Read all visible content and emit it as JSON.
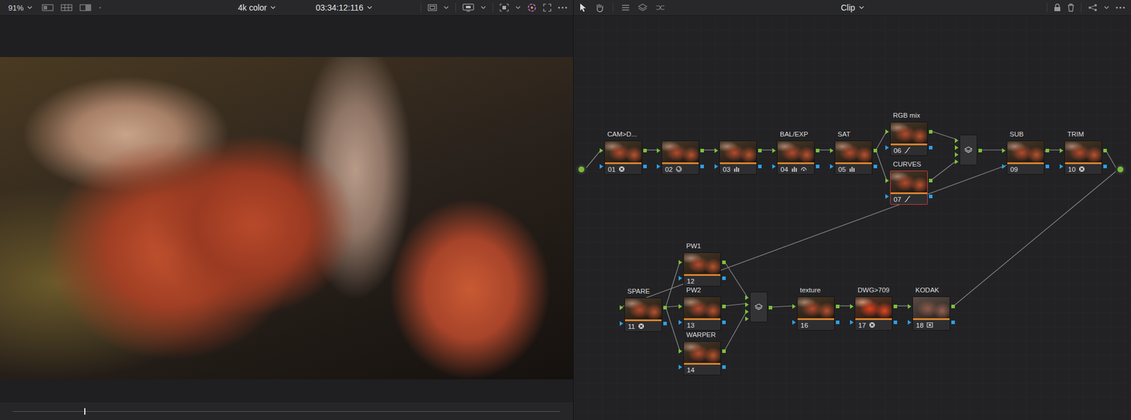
{
  "viewer": {
    "zoom": "91%",
    "timeline": "4k color",
    "timecode": "03:34:12:116",
    "playhead": {
      "level": 0.13
    }
  },
  "node_editor": {
    "mode": "Clip"
  },
  "nodes": [
    {
      "number": "01",
      "label": "CAM>D...",
      "selected": false,
      "tools": [
        "csc"
      ]
    },
    {
      "number": "02",
      "label": "",
      "selected": false,
      "tools": [
        "qualifier"
      ]
    },
    {
      "number": "03",
      "label": "",
      "selected": false,
      "tools": [
        "levels"
      ]
    },
    {
      "number": "04",
      "label": "BAL/EXP",
      "selected": false,
      "tools": [
        "levels",
        "hdr"
      ]
    },
    {
      "number": "05",
      "label": "SAT",
      "selected": false,
      "tools": [
        "levels"
      ]
    },
    {
      "number": "06",
      "label": "RGB mix",
      "selected": false,
      "tools": [
        "curve"
      ]
    },
    {
      "number": "07",
      "label": "CURVES",
      "selected": true,
      "tools": [
        "curve"
      ]
    },
    {
      "number": "09",
      "label": "SUB",
      "selected": false,
      "tools": []
    },
    {
      "number": "10",
      "label": "TRIM",
      "selected": false,
      "tools": [
        "csc"
      ]
    },
    {
      "number": "11",
      "label": "SPARE",
      "selected": false,
      "tools": [
        "csc"
      ]
    },
    {
      "number": "12",
      "label": "PW1",
      "selected": false,
      "tools": []
    },
    {
      "number": "13",
      "label": "PW2",
      "selected": false,
      "tools": []
    },
    {
      "number": "14",
      "label": "WARPER",
      "selected": false,
      "tools": []
    },
    {
      "number": "16",
      "label": "texture",
      "selected": false,
      "tools": []
    },
    {
      "number": "17",
      "label": "DWG>709",
      "selected": false,
      "tools": [
        "csc"
      ]
    },
    {
      "number": "18",
      "label": "KODAK",
      "selected": false,
      "tools": [
        "lut"
      ]
    }
  ]
}
